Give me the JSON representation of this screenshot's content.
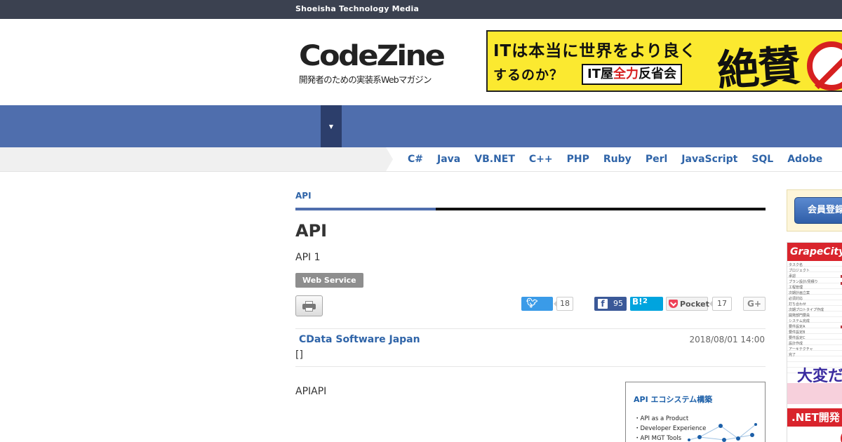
{
  "topbar": {
    "brand": "Shoeisha Technology Media"
  },
  "logo": {
    "name": "CodeZine",
    "tagline": "開発者のための実装系Webマガジン"
  },
  "banner": {
    "line1": "ITは本当に世界をより良く",
    "line2": "するのか？",
    "box_prefix": "IT屋",
    "box_red": "全力",
    "box_suffix": "反省会",
    "big": "絶賛"
  },
  "nav": {
    "menu_icon": "▼"
  },
  "languages": [
    "C#",
    "Java",
    "VB.NET",
    "C++",
    "PHP",
    "Ruby",
    "Perl",
    "JavaScript",
    "SQL",
    "Adobe"
  ],
  "article": {
    "category": "API",
    "title": "API",
    "subtitle": "API 1",
    "tag": "Web Service",
    "author": "CData Software Japan",
    "date": "2018/08/01 14:00",
    "brackets": "[]",
    "body": "APIAPI"
  },
  "social": {
    "twitter_count": "18",
    "facebook_count": "95",
    "hatena_label": "B!",
    "hatena_count": "2",
    "pocket_label": "Pocket",
    "pocket_count": "17",
    "gplus_label": "G+"
  },
  "figure": {
    "title": "API エコシステム構築",
    "items": [
      "・API as a Product",
      "・Developer Experience",
      "・API MGT Tools"
    ]
  },
  "sidebar": {
    "login_label": "会員登録",
    "ad_brand": "GrapeCity",
    "ad_rows": [
      "タスク名",
      "プロジェクト",
      "承認",
      "プラン設計/見積り",
      "工程管理",
      "次期計画立案",
      "必須対応",
      "打ち合わせ",
      "次期プロトタイプ作成",
      "開発部門要員",
      "システム完成",
      "要件設定A",
      "要件設定B",
      "要件設定C",
      "設計作成",
      "アーキテクチャ",
      "完了"
    ],
    "ad_big": "大変だ",
    "ad_net": ".NET開発"
  },
  "colors": {
    "topbar": "#3b4150",
    "nav": "#4f6ead",
    "link": "#2f64a8",
    "banner": "#fbe930",
    "ad_red": "#d9242c"
  }
}
